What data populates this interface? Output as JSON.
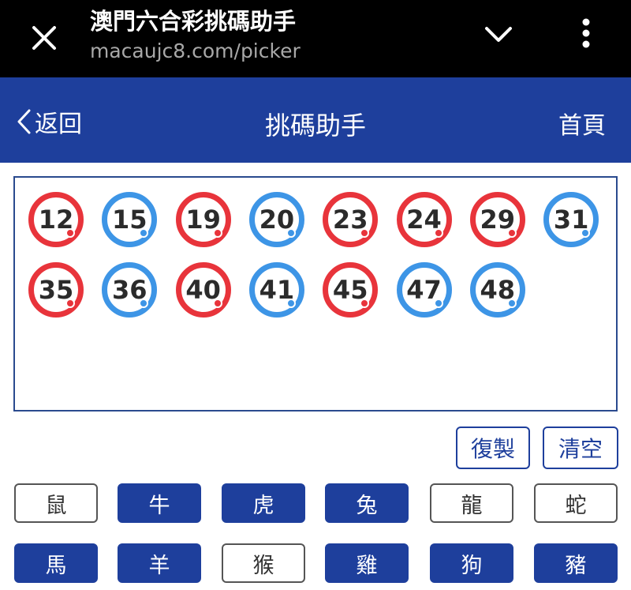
{
  "browser": {
    "page_title": "澳門六合彩挑碼助手",
    "url": "macaujc8.com/picker"
  },
  "header": {
    "back_label": "返回",
    "title": "挑碼助手",
    "home_label": "首頁"
  },
  "picked_numbers": [
    {
      "number": "12",
      "color": "red"
    },
    {
      "number": "15",
      "color": "blue"
    },
    {
      "number": "19",
      "color": "red"
    },
    {
      "number": "20",
      "color": "blue"
    },
    {
      "number": "23",
      "color": "red"
    },
    {
      "number": "24",
      "color": "red"
    },
    {
      "number": "29",
      "color": "red"
    },
    {
      "number": "31",
      "color": "blue"
    },
    {
      "number": "35",
      "color": "red"
    },
    {
      "number": "36",
      "color": "blue"
    },
    {
      "number": "40",
      "color": "red"
    },
    {
      "number": "41",
      "color": "blue"
    },
    {
      "number": "45",
      "color": "red"
    },
    {
      "number": "47",
      "color": "blue"
    },
    {
      "number": "48",
      "color": "blue"
    }
  ],
  "actions": {
    "copy_label": "復製",
    "clear_label": "清空"
  },
  "zodiacs": [
    {
      "label": "鼠",
      "selected": false
    },
    {
      "label": "牛",
      "selected": true
    },
    {
      "label": "虎",
      "selected": true
    },
    {
      "label": "兔",
      "selected": true
    },
    {
      "label": "龍",
      "selected": false
    },
    {
      "label": "蛇",
      "selected": false
    },
    {
      "label": "馬",
      "selected": true
    },
    {
      "label": "羊",
      "selected": true
    },
    {
      "label": "猴",
      "selected": false
    },
    {
      "label": "雞",
      "selected": true
    },
    {
      "label": "狗",
      "selected": true
    },
    {
      "label": "豬",
      "selected": true
    }
  ],
  "colors": {
    "brand_blue": "#1e3f9c",
    "ball_red": "#e8343b",
    "ball_blue": "#3d95e6"
  }
}
